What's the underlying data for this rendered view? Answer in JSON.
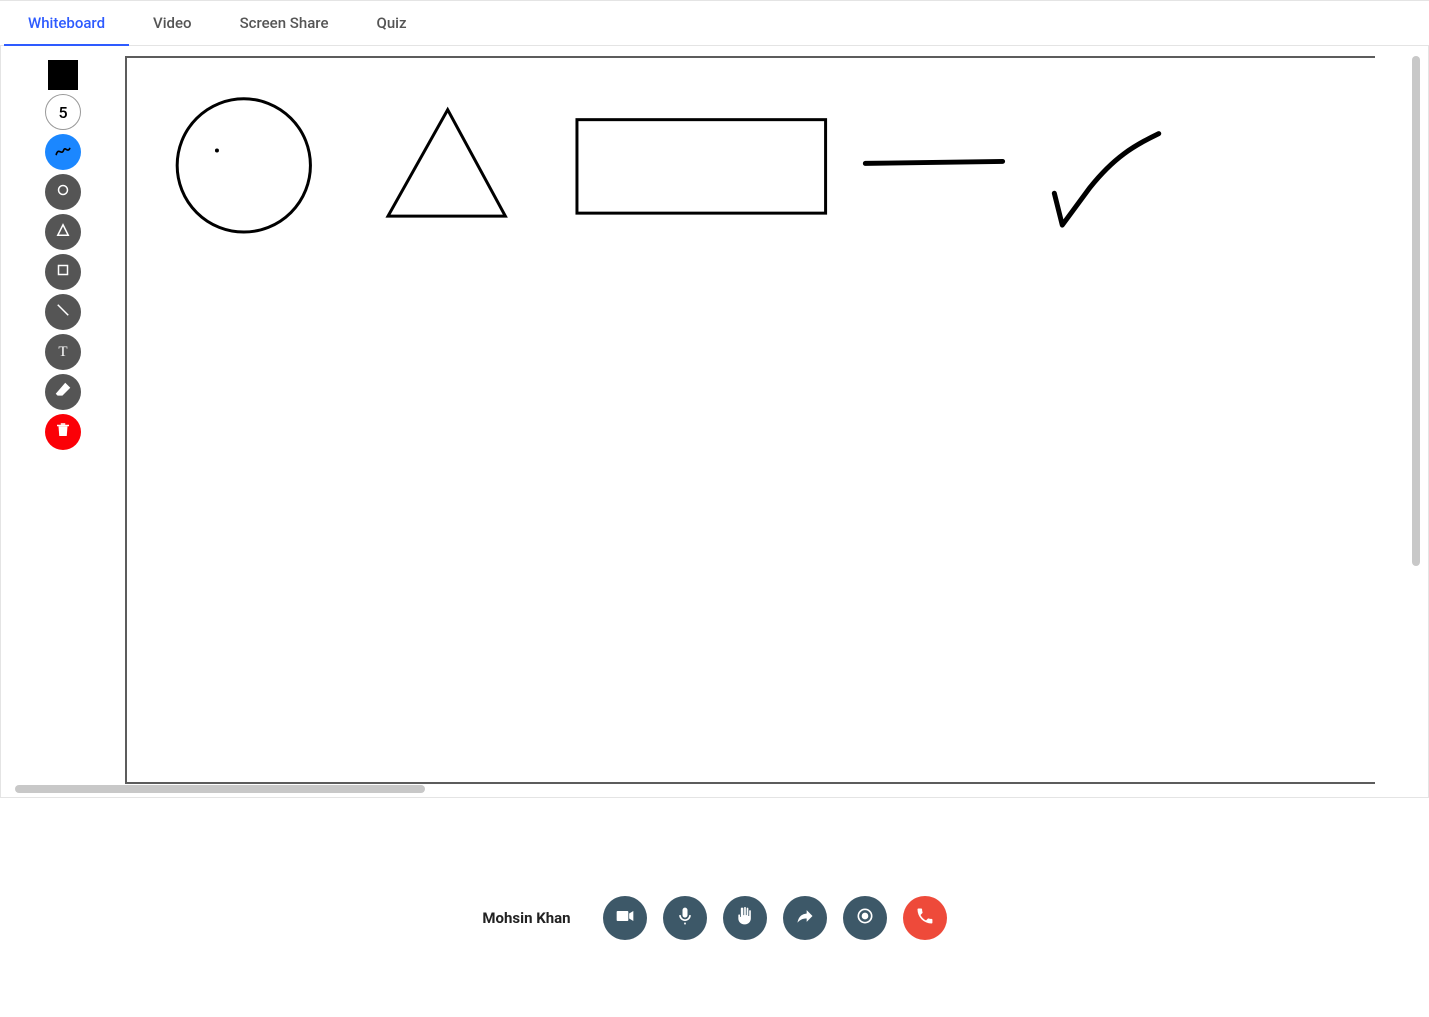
{
  "tabs": {
    "whiteboard": "Whiteboard",
    "video": "Video",
    "screen_share": "Screen Share",
    "quiz": "Quiz",
    "active": "whiteboard"
  },
  "toolbar": {
    "swatch_color": "#000000",
    "brush_size": "5",
    "active_tool": "freehand",
    "tools": {
      "freehand": "freehand-tool",
      "circle": "circle-tool",
      "triangle": "triangle-tool",
      "square": "square-tool",
      "line": "line-tool",
      "text": "text-tool",
      "eraser": "eraser-tool",
      "clear": "clear-tool"
    }
  },
  "canvas": {
    "stroke_color": "#000000",
    "drawings": [
      "circle",
      "triangle",
      "rectangle",
      "line",
      "checkmark"
    ]
  },
  "call_bar": {
    "user_name": "Mohsin Khan",
    "buttons": {
      "camera": "camera",
      "mic": "microphone",
      "hand": "raise-hand",
      "share": "share",
      "record": "record",
      "hangup": "hang-up"
    }
  }
}
